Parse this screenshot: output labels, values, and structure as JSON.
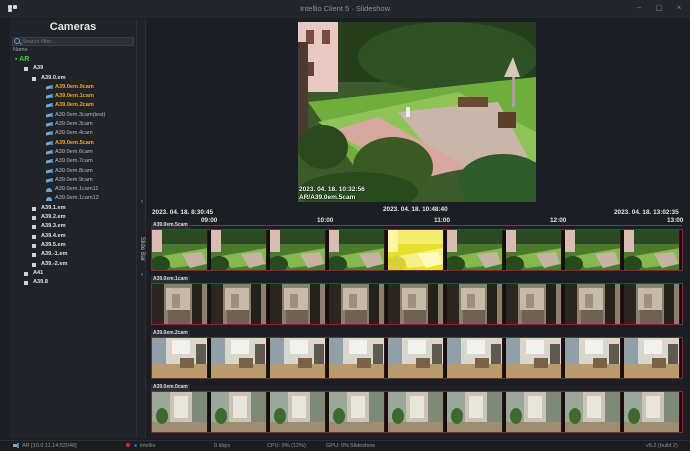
{
  "window": {
    "title": "Intellio Client 5 · Slideshow",
    "controls": [
      "–",
      "▢",
      "×"
    ]
  },
  "sidebar": {
    "title": "Cameras",
    "search_placeholder": "Search filter...",
    "column_header": "Name",
    "tree": [
      {
        "label": "AR",
        "kind": "root",
        "depth": 0
      },
      {
        "label": "A39",
        "kind": "group",
        "depth": 1
      },
      {
        "label": "A39.0.em",
        "kind": "group",
        "depth": 2
      },
      {
        "label": "A39.0em.0cam",
        "kind": "cam",
        "depth": 3,
        "active": true
      },
      {
        "label": "A39.0em.1cam",
        "kind": "cam",
        "depth": 3,
        "active": true
      },
      {
        "label": "A39.0em.2cam",
        "kind": "cam",
        "depth": 3,
        "active": true
      },
      {
        "label": "A39.0em.3cam(test)",
        "kind": "cam",
        "depth": 3
      },
      {
        "label": "A39.0em.3cam",
        "kind": "cam",
        "depth": 3
      },
      {
        "label": "A39.0em.4cam",
        "kind": "cam",
        "depth": 3
      },
      {
        "label": "A39.0em.5cam",
        "kind": "cam",
        "depth": 3,
        "active": true
      },
      {
        "label": "A39.0em.6cam",
        "kind": "cam",
        "depth": 3
      },
      {
        "label": "A39.0em.7cam",
        "kind": "cam",
        "depth": 3
      },
      {
        "label": "A39.0em.8cam",
        "kind": "cam",
        "depth": 3
      },
      {
        "label": "A39.0em.9cam",
        "kind": "cam",
        "depth": 3
      },
      {
        "label": "A39.0em.1cam11",
        "kind": "cam",
        "depth": 3,
        "dome": true
      },
      {
        "label": "A39.0em.1cam12",
        "kind": "cam",
        "depth": 3,
        "dome": true
      },
      {
        "label": "A39.1.em",
        "kind": "group",
        "depth": 2
      },
      {
        "label": "A39.2.em",
        "kind": "group",
        "depth": 2
      },
      {
        "label": "A39.3.em",
        "kind": "group",
        "depth": 2
      },
      {
        "label": "A39.4.em",
        "kind": "group",
        "depth": 2
      },
      {
        "label": "A39.5.em",
        "kind": "group",
        "depth": 2
      },
      {
        "label": "A39.-1.em",
        "kind": "group",
        "depth": 2
      },
      {
        "label": "A39.-2.em",
        "kind": "group",
        "depth": 2
      },
      {
        "label": "A41",
        "kind": "group",
        "depth": 1
      },
      {
        "label": "A39.8",
        "kind": "group",
        "depth": 1
      }
    ]
  },
  "slide_bar": {
    "label": "Slide Bar",
    "arrow_top": "‹",
    "arrow_bottom": "‹"
  },
  "video": {
    "timestamp": "2023. 04. 18. 10:32:56",
    "camera": "AR/A39.0em.5cam"
  },
  "timeline": {
    "start": "2023. 04. 18. 8:30:45",
    "current": "2023. 04. 18. 10:48:40",
    "end": "2023. 04. 18. 13:02:35",
    "ticks": [
      "09:00",
      "10:00",
      "11:00",
      "12:00",
      "13:00"
    ]
  },
  "strips": [
    {
      "label": "A39.0em.5cam",
      "frames": 9,
      "highlight_index": 4,
      "scene": "garden"
    },
    {
      "label": "A39.0em.1cam",
      "frames": 9,
      "scene": "corridor"
    },
    {
      "label": "A39.0em.2cam",
      "frames": 9,
      "scene": "lobby"
    },
    {
      "label": "A39.0em.0cam",
      "frames": 9,
      "scene": "entrance"
    }
  ],
  "status": {
    "connection": "AR [10.0.11.14:52048]",
    "user": "intellio",
    "bandwidth": "0 kbps",
    "cpu": "CPU: 9% (12%)",
    "gpu": "GPU: 0%",
    "mode": "Slideshow",
    "version": "v5.2 (build 2)"
  },
  "colors": {
    "accent_active": "#f0a324",
    "root_green": "#3bd13b",
    "strip_border": "#7b2d34",
    "highlight_frame": "#e6e02a"
  }
}
